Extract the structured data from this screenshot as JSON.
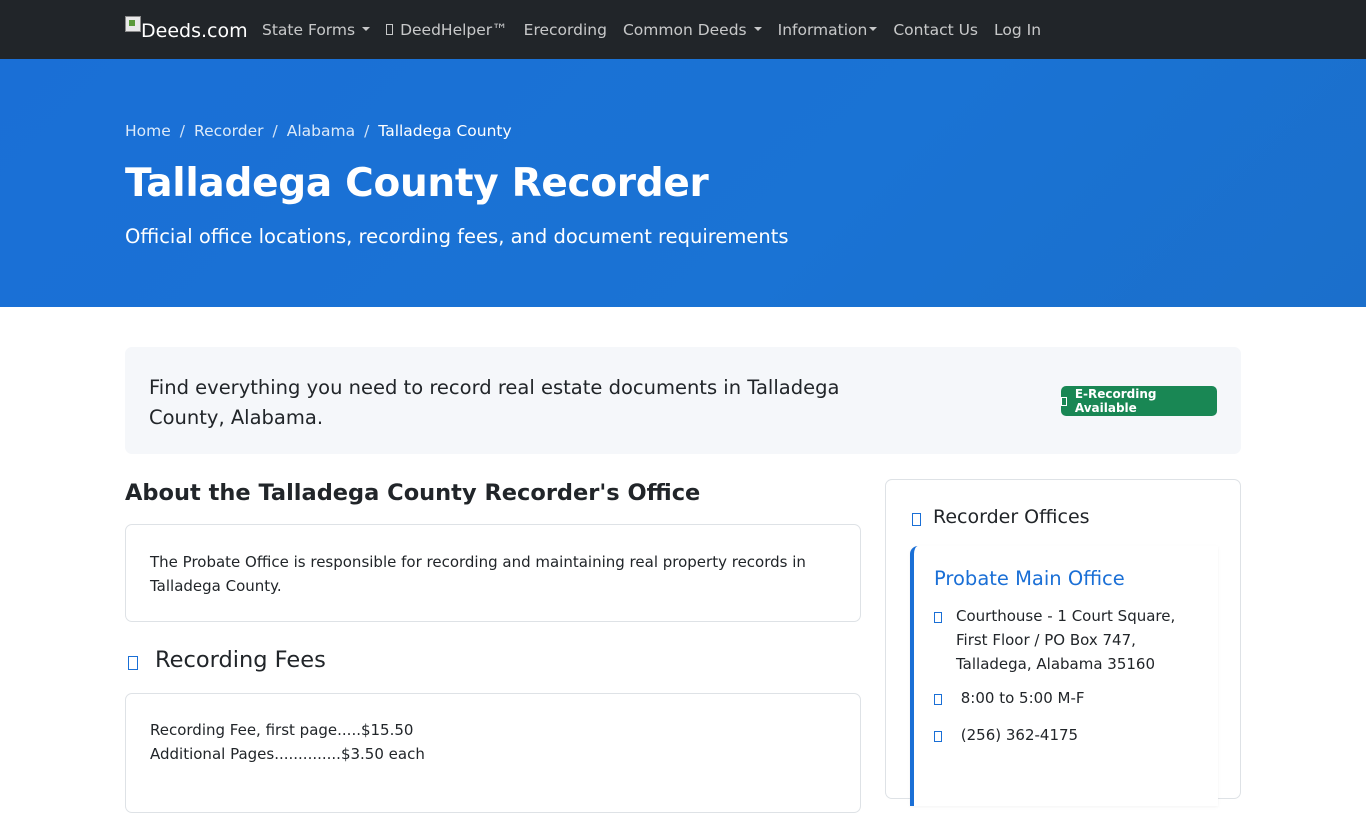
{
  "navbar": {
    "brand": "Deeds.com",
    "items": [
      {
        "label": "State Forms",
        "dropdown": true
      },
      {
        "label": "DeedHelper™",
        "icon": "sparkle-icon"
      },
      {
        "label": "Erecording"
      },
      {
        "label": "Common Deeds",
        "dropdown": true
      },
      {
        "label": "Information",
        "dropdown": true
      },
      {
        "label": "Contact Us"
      },
      {
        "label": "Log In"
      }
    ]
  },
  "hero": {
    "breadcrumb": [
      "Home",
      "Recorder",
      "Alabama",
      "Talladega County"
    ],
    "title": "Talladega County Recorder",
    "subtitle": "Official office locations, recording fees, and document requirements"
  },
  "intro": {
    "text": "Find everything you need to record real estate documents in Talladega County, Alabama.",
    "badge": "E-Recording Available"
  },
  "about": {
    "title": "About the Talladega County Recorder's Office",
    "body": "The Probate Office is responsible for recording and maintaining real property records in Talladega County."
  },
  "fees": {
    "title": "Recording Fees",
    "lines": [
      "Recording Fee, first page.....$15.50",
      "Additional Pages..............$3.50 each"
    ]
  },
  "sidebar": {
    "title": "Recorder Offices",
    "office": {
      "name": "Probate Main Office",
      "address": "Courthouse - 1 Court Square, First Floor / PO Box 747, Talladega, Alabama 35160",
      "hours": " 8:00 to 5:00 M-F",
      "phone": " (256) 362-4175"
    }
  },
  "colors": {
    "navbar_bg": "#212529",
    "hero_bg": "#1a6fd6",
    "badge_green": "#198754",
    "accent_blue": "#1a6fd6"
  }
}
